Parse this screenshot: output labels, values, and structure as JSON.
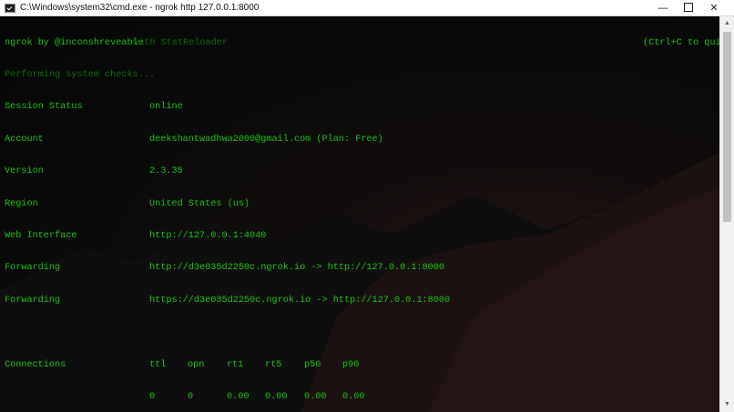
{
  "window": {
    "title": "C:\\Windows\\system32\\cmd.exe - ngrok  http 127.0.0.1:8000",
    "minimize_glyph": "—",
    "close_glyph": "✕"
  },
  "terminal": {
    "header": {
      "brand": "ngrok by @inconshreveable",
      "subtitle": "with StatReloader",
      "hint": "(Ctrl+C to quit)"
    },
    "system_check": "Performing system checks...",
    "status_rows": [
      {
        "label": "Session Status",
        "value": "online"
      },
      {
        "label": "Account",
        "value": "deekshantwadhwa2000@gmail.com (Plan: Free)"
      },
      {
        "label": "Version",
        "value": "2.3.35"
      },
      {
        "label": "Region",
        "value": "United States (us)"
      },
      {
        "label": "Web Interface",
        "value": "http://127.0.0.1:4040"
      },
      {
        "label": "Forwarding",
        "value": "http://d3e035d2250c.ngrok.io -> http://127.0.0.1:8000"
      },
      {
        "label": "Forwarding",
        "value": "https://d3e035d2250c.ngrok.io -> http://127.0.0.1:8000"
      }
    ],
    "connections": {
      "label": "Connections",
      "headers": [
        "ttl",
        "opn",
        "rt1",
        "rt5",
        "p50",
        "p90"
      ],
      "values": [
        "0",
        "0",
        "0.00",
        "0.00",
        "0.00",
        "0.00"
      ]
    }
  },
  "scrollbar": {
    "up_glyph": "▲",
    "down_glyph": "▼",
    "position": 0
  },
  "colors": {
    "terminal_text": "#16c60c",
    "terminal_bg": "#0c0c0c",
    "titlebar_bg": "#ffffff"
  }
}
